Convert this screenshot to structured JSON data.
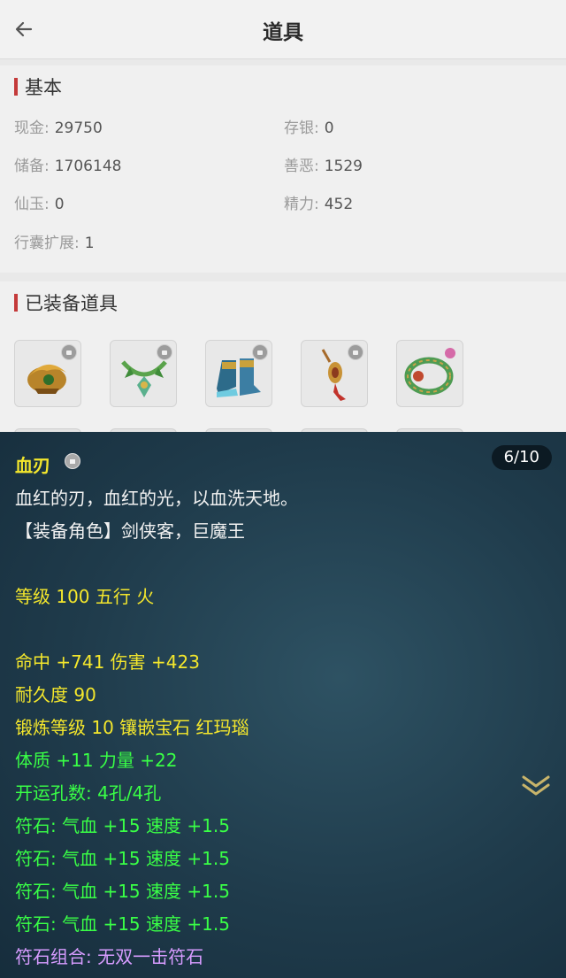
{
  "header": {
    "title": "道具"
  },
  "basic": {
    "title": "基本",
    "fields": [
      {
        "label": "现金:",
        "value": "29750"
      },
      {
        "label": "存银:",
        "value": "0"
      },
      {
        "label": "储备:",
        "value": "1706148"
      },
      {
        "label": "善恶:",
        "value": "1529"
      },
      {
        "label": "仙玉:",
        "value": "0"
      },
      {
        "label": "精力:",
        "value": "452"
      },
      {
        "label": "行囊扩展:",
        "value": "1"
      }
    ]
  },
  "equipped": {
    "title": "已装备道具",
    "items": [
      {
        "icon": "dragon-helmet-icon"
      },
      {
        "icon": "jade-necklace-icon"
      },
      {
        "icon": "armored-boots-icon"
      },
      {
        "icon": "red-pendant-icon"
      },
      {
        "icon": "jade-bracelet-icon"
      }
    ]
  },
  "tooltip": {
    "name": "血刃",
    "counter": "6/10",
    "desc": "血红的刃，血红的光，以血洗天地。",
    "roles": "【装备角色】剑侠客，巨魔王",
    "level": "等级 100 五行 火",
    "attack": "命中 +741 伤害 +423",
    "durability": "耐久度 90",
    "forge": "锻炼等级 10 镶嵌宝石 红玛瑙",
    "bonus": "体质 +11 力量 +22",
    "holes": "开运孔数: 4孔/4孔",
    "runes": [
      "符石: 气血 +15 速度 +1.5",
      "符石: 气血 +15 速度 +1.5",
      "符石: 气血 +15 速度 +1.5",
      "符石: 气血 +15 速度 +1.5"
    ],
    "combo": "符石组合: 无双一击符石",
    "colors": {
      "name": "#f4e72c",
      "stat": "#f4e72c",
      "rune": "#39ff46",
      "combo": "#d79cff"
    }
  }
}
